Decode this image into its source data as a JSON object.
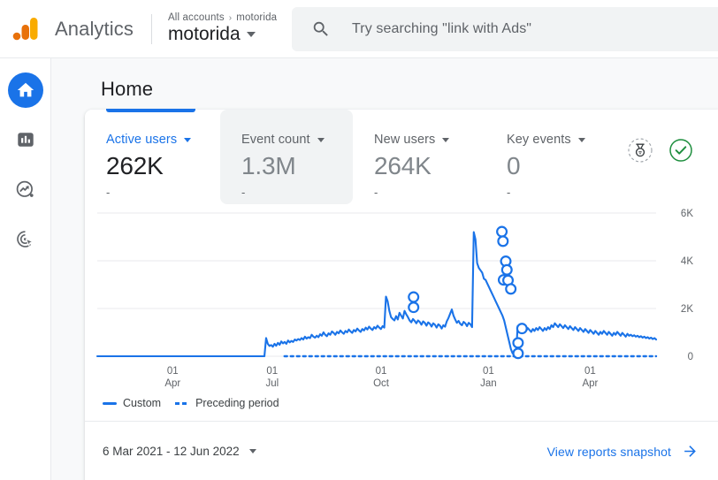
{
  "header": {
    "brand": "Analytics",
    "logo_icon": "analytics-logo",
    "breadcrumb_root": "All accounts",
    "breadcrumb_sep": "›",
    "breadcrumb_current": "motorida",
    "account_name": "motorida",
    "account_caret_icon": "caret-down-icon"
  },
  "search": {
    "icon": "search-icon",
    "placeholder": "Try searching \"link with Ads\""
  },
  "sidebar": {
    "items": [
      {
        "name": "home",
        "icon": "home-icon",
        "active": true
      },
      {
        "name": "reports",
        "icon": "bar-chart-icon",
        "active": false
      },
      {
        "name": "explore",
        "icon": "explore-trending-icon",
        "active": false
      },
      {
        "name": "advertising",
        "icon": "advertising-target-icon",
        "active": false
      }
    ]
  },
  "page": {
    "title": "Home"
  },
  "metrics": [
    {
      "label": "Active users",
      "value": "262K",
      "delta": "-",
      "selected": true,
      "hover": false,
      "caret": "caret-down-icon"
    },
    {
      "label": "Event count",
      "value": "1.3M",
      "delta": "-",
      "selected": false,
      "hover": true,
      "caret": "caret-down-icon"
    },
    {
      "label": "New users",
      "value": "264K",
      "delta": "-",
      "selected": false,
      "hover": false,
      "caret": "caret-down-icon"
    },
    {
      "label": "Key events",
      "value": "0",
      "delta": "-",
      "selected": false,
      "hover": false,
      "caret": "caret-down-icon"
    }
  ],
  "badges": [
    {
      "name": "insights-medal-badge",
      "icon": "medal-icon"
    },
    {
      "name": "data-quality-check-badge",
      "icon": "check-circle-icon",
      "color": "#1e8e3e"
    }
  ],
  "legend": [
    {
      "label": "Custom",
      "style": "solid",
      "color": "#1a73e8"
    },
    {
      "label": "Preceding period",
      "style": "dashed",
      "color": "#1a73e8"
    }
  ],
  "footer": {
    "date_range": "6 Mar 2021 - 12 Jun 2022",
    "date_caret_icon": "caret-down-icon",
    "snapshot_link": "View reports snapshot",
    "snapshot_arrow_icon": "arrow-right-icon"
  },
  "colors": {
    "accent_blue": "#1a73e8",
    "green": "#1e8e3e",
    "logo_orange": "#f9ab00",
    "logo_orange_dark": "#e8710a",
    "text_primary": "#202124",
    "text_secondary": "#5f6368",
    "surface": "#f8f9fa"
  },
  "chart_data": {
    "type": "line",
    "title": "",
    "xlabel": "",
    "ylabel": "",
    "ylim": [
      0,
      6000
    ],
    "yticks": [
      0,
      2000,
      4000,
      6000
    ],
    "ytick_labels": [
      "0",
      "2K",
      "4K",
      "6K"
    ],
    "grid": true,
    "legend_position": "bottom-left",
    "xticks": [
      {
        "pos": 0.135,
        "line1": "01",
        "line2": "Apr"
      },
      {
        "pos": 0.313,
        "line1": "01",
        "line2": "Jul"
      },
      {
        "pos": 0.508,
        "line1": "01",
        "line2": "Oct"
      },
      {
        "pos": 0.7,
        "line1": "01",
        "line2": "Jan"
      },
      {
        "pos": 0.882,
        "line1": "01",
        "line2": "Apr"
      }
    ],
    "series": [
      {
        "name": "Custom",
        "style": "solid",
        "color": "#1a73e8",
        "values": [
          0,
          0,
          0,
          0,
          0,
          0,
          0,
          0,
          0,
          0,
          0,
          0,
          0,
          0,
          0,
          0,
          0,
          0,
          0,
          0,
          0,
          0,
          0,
          0,
          0,
          0,
          0,
          0,
          0,
          0,
          0,
          0,
          0,
          0,
          0,
          0,
          0,
          0,
          0,
          0,
          0,
          0,
          0,
          0,
          0,
          0,
          0,
          0,
          0,
          0,
          0,
          0,
          0,
          0,
          0,
          0,
          0,
          0,
          0,
          0,
          0,
          0,
          0,
          0,
          0,
          0,
          0,
          0,
          0,
          0,
          0,
          0,
          0,
          0,
          0,
          0,
          0,
          0,
          0,
          0,
          0,
          0,
          0,
          0,
          0,
          0,
          0,
          0,
          0,
          0,
          0,
          0,
          0,
          0,
          0,
          0,
          0,
          0,
          0,
          0,
          760,
          520,
          430,
          470,
          400,
          520,
          440,
          560,
          480,
          620,
          540,
          600,
          520,
          660,
          580,
          640,
          600,
          700,
          660,
          720,
          680,
          760,
          700,
          820,
          740,
          800,
          760,
          900,
          820,
          780,
          860,
          800,
          920,
          860,
          1000,
          900,
          840,
          960,
          900,
          1040,
          980,
          900,
          1020,
          960,
          1080,
          1000,
          940,
          1060,
          1000,
          1120,
          1040,
          980,
          1100,
          1040,
          1160,
          1080,
          1020,
          1140,
          1080,
          1200,
          1120,
          1240,
          1160,
          1100,
          1220,
          1160,
          1280,
          1200,
          1140,
          1260,
          1200,
          2500,
          2300,
          1900,
          1640,
          1560,
          1500,
          1680,
          1540,
          1820,
          1700,
          1580,
          1900,
          1760,
          1640,
          1500,
          1420,
          1560,
          1480,
          1380,
          1500,
          1440,
          1320,
          1460,
          1400,
          1280,
          1420,
          1360,
          1240,
          1380,
          1320,
          1200,
          1340,
          1280,
          1160,
          1300,
          1240,
          1460,
          1600,
          1780,
          1960,
          1700,
          1540,
          1400,
          1480,
          1360,
          1300,
          1440,
          1380,
          1260,
          1400,
          1340,
          1220,
          5200,
          4900,
          3900,
          3700,
          3600,
          3500,
          3250,
          3200,
          3050,
          2900,
          2750,
          2600,
          2450,
          2300,
          2150,
          2000,
          1850,
          1700,
          1500,
          1200,
          900,
          600,
          300,
          120,
          60,
          40,
          1260,
          1180,
          1100,
          1220,
          1140,
          1060,
          1180,
          1100,
          1020,
          1140,
          1060,
          1180,
          1100,
          1220,
          1140,
          1060,
          1180,
          1100,
          1220,
          1140,
          1300,
          1220,
          1380,
          1300,
          1220,
          1340,
          1260,
          1180,
          1300,
          1220,
          1140,
          1260,
          1180,
          1100,
          1220,
          1140,
          1060,
          1180,
          1100,
          1020,
          1140,
          1060,
          980,
          1100,
          1020,
          940,
          1060,
          980,
          900,
          1020,
          940,
          1060,
          980,
          900,
          1020,
          940,
          860,
          980,
          900,
          1020,
          940,
          860,
          980,
          900,
          820,
          940,
          860,
          900,
          840,
          880,
          820,
          860,
          800,
          840,
          780,
          820,
          760,
          800,
          740,
          780,
          720,
          760,
          700
        ]
      },
      {
        "name": "Preceding period",
        "style": "dashed",
        "color": "#1a73e8",
        "constant_value": 0,
        "start_fraction": 0.335
      }
    ],
    "anomaly_markers": [
      {
        "x_fraction": 0.566,
        "value": 2480
      },
      {
        "x_fraction": 0.566,
        "value": 2050
      },
      {
        "x_fraction": 0.724,
        "value": 5220
      },
      {
        "x_fraction": 0.726,
        "value": 4820
      },
      {
        "x_fraction": 0.731,
        "value": 3980
      },
      {
        "x_fraction": 0.733,
        "value": 3620
      },
      {
        "x_fraction": 0.727,
        "value": 3200
      },
      {
        "x_fraction": 0.735,
        "value": 3180
      },
      {
        "x_fraction": 0.74,
        "value": 2820
      },
      {
        "x_fraction": 0.76,
        "value": 1160
      },
      {
        "x_fraction": 0.753,
        "value": 560
      },
      {
        "x_fraction": 0.753,
        "value": 120
      }
    ]
  }
}
